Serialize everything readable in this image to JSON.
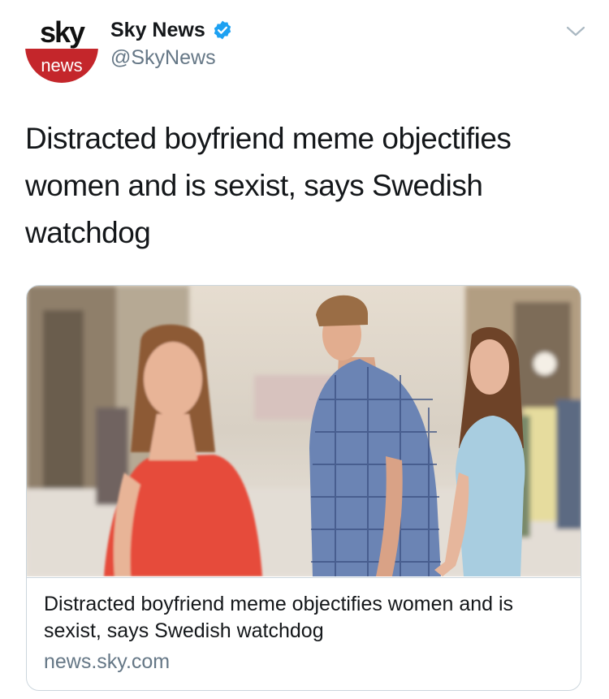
{
  "account": {
    "avatar_logo_top": "sky",
    "avatar_logo_bottom": "news",
    "display_name": "Sky News",
    "handle": "@SkyNews",
    "verified": true
  },
  "tweet": {
    "text": "Distracted boyfriend meme objectifies women and is sexist, says Swedish watchdog"
  },
  "link_card": {
    "title": "Distracted boyfriend meme objectifies women and is sexist, says Swedish watchdog",
    "domain": "news.sky.com"
  },
  "colors": {
    "brand_red": "#c4262b",
    "verified_blue": "#1da1f2",
    "text": "#14171a",
    "muted": "#657786",
    "border": "#ccd6dd"
  },
  "icons": {
    "verified": "verified-badge-icon",
    "menu": "chevron-down-icon"
  }
}
